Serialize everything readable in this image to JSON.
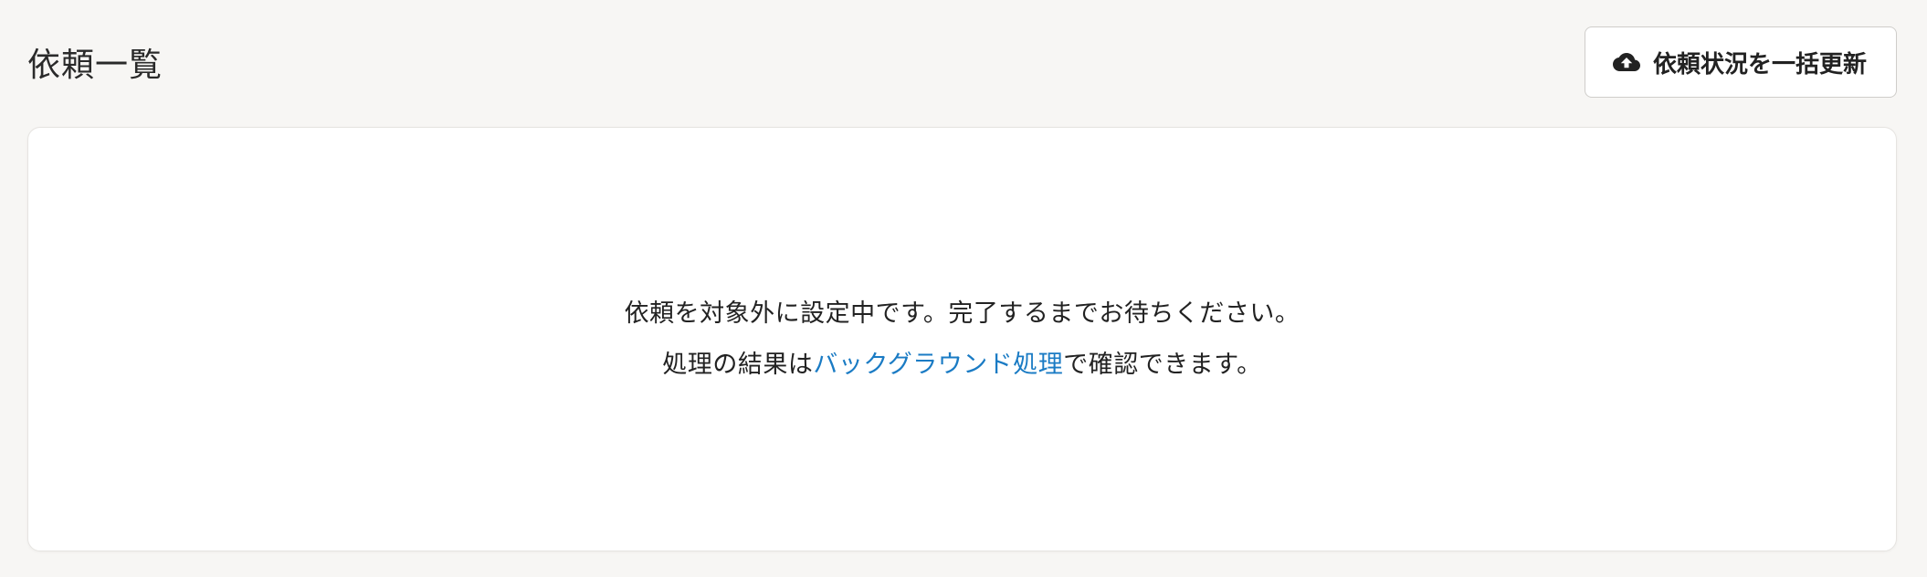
{
  "header": {
    "title": "依頼一覧",
    "bulk_update_label": "依頼状況を一括更新",
    "bulk_update_icon": "cloud-upload-icon"
  },
  "main": {
    "message_line1": "依頼を対象外に設定中です。完了するまでお待ちください。",
    "message_line2_prefix": "処理の結果は",
    "message_line2_link": "バックグラウンド処理",
    "message_line2_suffix": "で確認できます。"
  },
  "colors": {
    "background": "#f7f6f4",
    "card": "#ffffff",
    "link": "#1a7bc4",
    "text": "#222222"
  }
}
